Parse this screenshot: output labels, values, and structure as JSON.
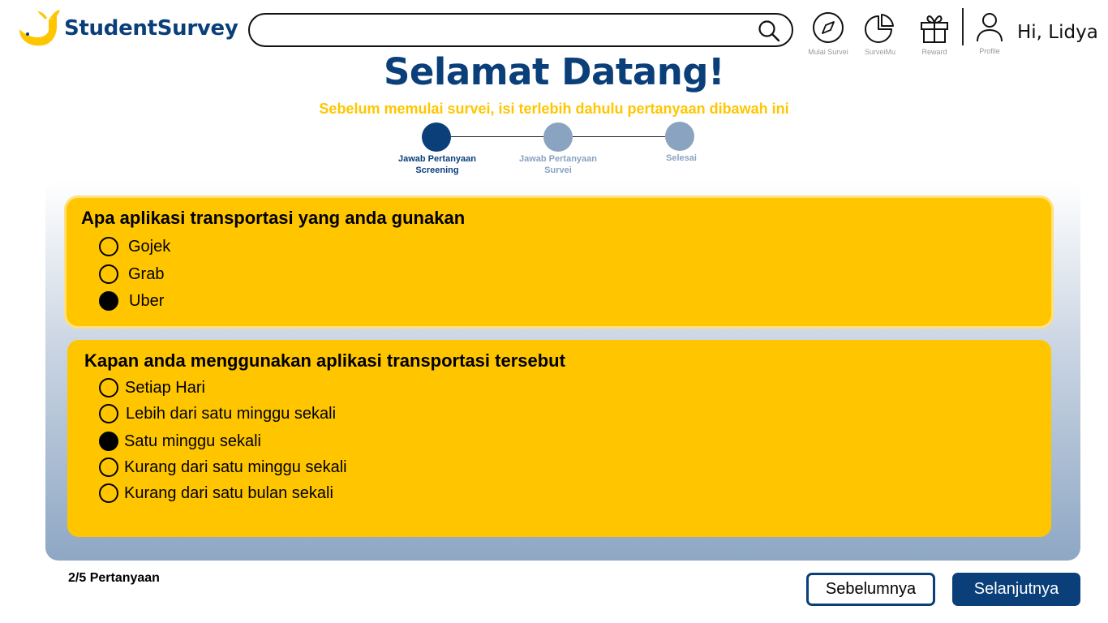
{
  "header": {
    "brand": "StudentSurvey",
    "search": {
      "value": "",
      "placeholder": ""
    },
    "nav": [
      {
        "label": "Mulai Survei",
        "icon": "compass-icon"
      },
      {
        "label": "SurveiMu",
        "icon": "pie-chart-icon"
      },
      {
        "label": "Reward",
        "icon": "gift-icon"
      },
      {
        "label": "Profile",
        "icon": "user-icon"
      }
    ],
    "greeting": "Hi, Lidya"
  },
  "page": {
    "title": "Selamat Datang!",
    "subtitle": "Sebelum memulai survei, isi terlebih dahulu pertanyaan dibawah ini"
  },
  "stepper": {
    "steps": [
      {
        "label": "Jawab Pertanyaan Screening",
        "status": "active"
      },
      {
        "label": "Jawab Pertanyaan Survei",
        "status": "inactive"
      },
      {
        "label": "Selesai",
        "status": "inactive"
      }
    ],
    "active_color": "#0a3f7a",
    "inactive_color": "#8aa3c0"
  },
  "questions": [
    {
      "text": "Apa aplikasi transportasi yang anda gunakan",
      "options": [
        {
          "label": "Gojek",
          "selected": false
        },
        {
          "label": "Grab",
          "selected": false
        },
        {
          "label": "Uber",
          "selected": true
        }
      ]
    },
    {
      "text": "Kapan anda menggunakan aplikasi transportasi tersebut",
      "options": [
        {
          "label": "Setiap Hari",
          "selected": false
        },
        {
          "label": "Lebih dari satu minggu sekali",
          "selected": false
        },
        {
          "label": "Satu minggu sekali",
          "selected": true
        },
        {
          "label": "Kurang dari satu minggu sekali",
          "selected": false
        },
        {
          "label": "Kurang dari satu bulan sekali",
          "selected": false
        }
      ]
    }
  ],
  "footer": {
    "progress": "2/5 Pertanyaan",
    "prev_label": "Sebelumnya",
    "next_label": "Selanjutnya"
  },
  "colors": {
    "brand": "#0a3f7a",
    "accent": "#ffc600"
  }
}
